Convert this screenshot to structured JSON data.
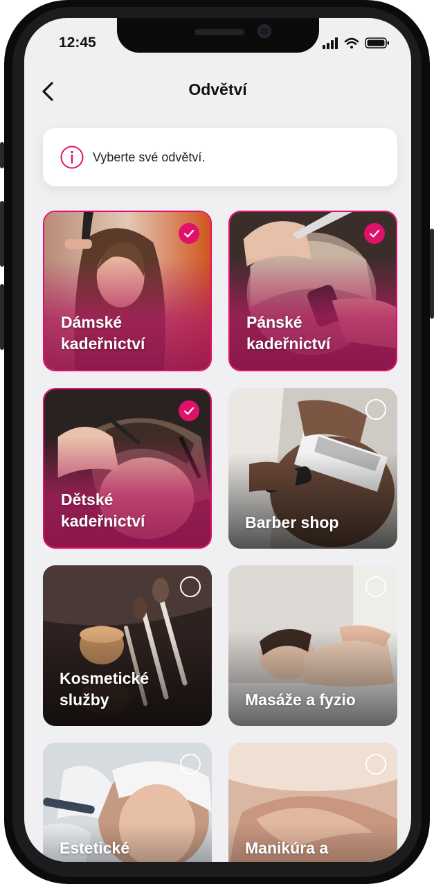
{
  "status_bar": {
    "time": "12:45"
  },
  "nav": {
    "title": "Odvětví"
  },
  "info": {
    "text": "Vyberte své odvětví."
  },
  "accent_color": "#e0116b",
  "categories": [
    {
      "label": "Dámské\nkadeřnictví",
      "selected": true
    },
    {
      "label": "Pánské\nkadeřnictví",
      "selected": true
    },
    {
      "label": "Dětské\nkadeřnictví",
      "selected": true
    },
    {
      "label": "Barber shop",
      "selected": false
    },
    {
      "label": "Kosmetické\nslužby",
      "selected": false
    },
    {
      "label": "Masáže a fyzio",
      "selected": false
    },
    {
      "label": "Estetické",
      "selected": false
    },
    {
      "label": "Manikúra a",
      "selected": false
    }
  ]
}
